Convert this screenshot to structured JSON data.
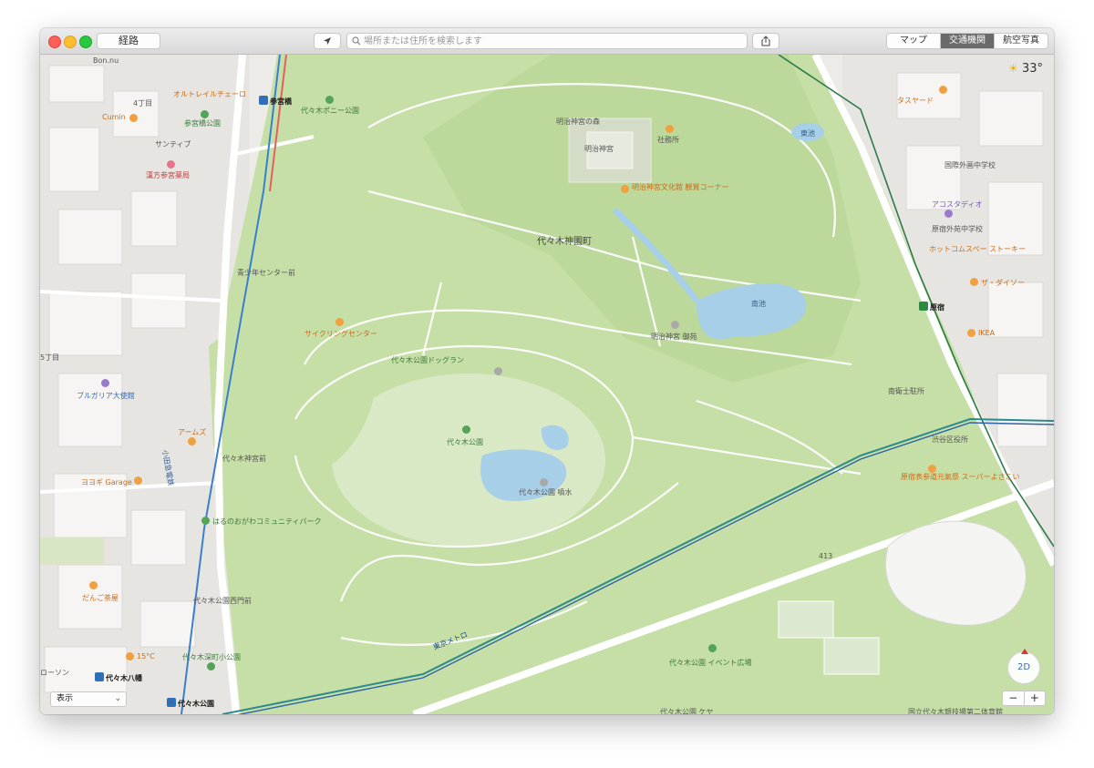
{
  "toolbar": {
    "directions_label": "経路",
    "location_icon": "location-arrow-icon",
    "search_placeholder": "場所または住所を検索します",
    "share_icon": "share-icon",
    "modes": [
      "マップ",
      "交通機関",
      "航空写真"
    ],
    "active_mode": "交通機関"
  },
  "weather": {
    "icon": "partly-cloudy-icon",
    "temp": "33°"
  },
  "map": {
    "areas": {
      "district": "代々木神園町",
      "bon": "Bon.nu",
      "chome4": "4丁目",
      "chome5": "5丁目"
    },
    "parks": {
      "yoyogi_park": "代々木公園",
      "dogrun": "代々木公園ドッグラン",
      "fountain": "代々木公園 噴水",
      "event_square": "代々木公園 イベント広場",
      "harunoogawa": "はるのおがわコミュニティパーク",
      "fukamachi": "代々木深町小公園",
      "pony": "代々木ポニー公園",
      "sangubashi_park": "参宮橋公園",
      "meiji_forest": "明治神宮の森",
      "meiji_shrine": "明治神宮",
      "meiji_sho": "明治神宮 御苑"
    },
    "water": {
      "minami_ike": "南池",
      "higashi_ike": "東池"
    },
    "places": {
      "cycling": "サイクリングセンター",
      "youth_center": "青少年センター前",
      "meiji_culture": "明治神宮文化館 観賞コーナー",
      "shamusho": "社務所",
      "olrail": "オルトレイルチェーロ",
      "cumin": "Cumin",
      "kanpo": "漢方参宮薬局",
      "saintif": "サンティブ",
      "bulgaria": "ブルガリア大使館",
      "arms": "アームズ",
      "yoyogi_garage": "ヨヨギ Garage",
      "dango": "だんご茶屋",
      "lawson": "ローソン",
      "temp15": "15°C",
      "yoyogi_west_gate": "代々木公園西門前",
      "yoyogi_bus": "代々木神宮前",
      "asajiya": "タスヤード",
      "tosho": "国際外画中学校",
      "acos": "アコスタディオ",
      "harajuku_ri": "原宿外苑中学校",
      "hot": "ホットコムスペー ストーキー",
      "daiso": "ザ・ダイソー",
      "ikea": "IKEA",
      "kouei": "南衛士駐所",
      "supermarket": "原宿表参道元氣祭 スーパーよさこい",
      "gym": "国立代々木競技場第二体育館",
      "yoyogi_hall": "代々木公園 ケヤ",
      "route": "413",
      "kiosk": "渋谷区役所"
    },
    "transit": {
      "sangubashi": "参宮橋",
      "yoyogi_hachiman": "代々木八幡",
      "yoyogi_koen": "代々木公園",
      "harajuku": "原宿",
      "odakyu": "小田急電鉄",
      "metro": "東京メトロ"
    }
  },
  "controls": {
    "view_label": "表示",
    "compass_label": "2D",
    "zoom_out": "−",
    "zoom_in": "+"
  }
}
